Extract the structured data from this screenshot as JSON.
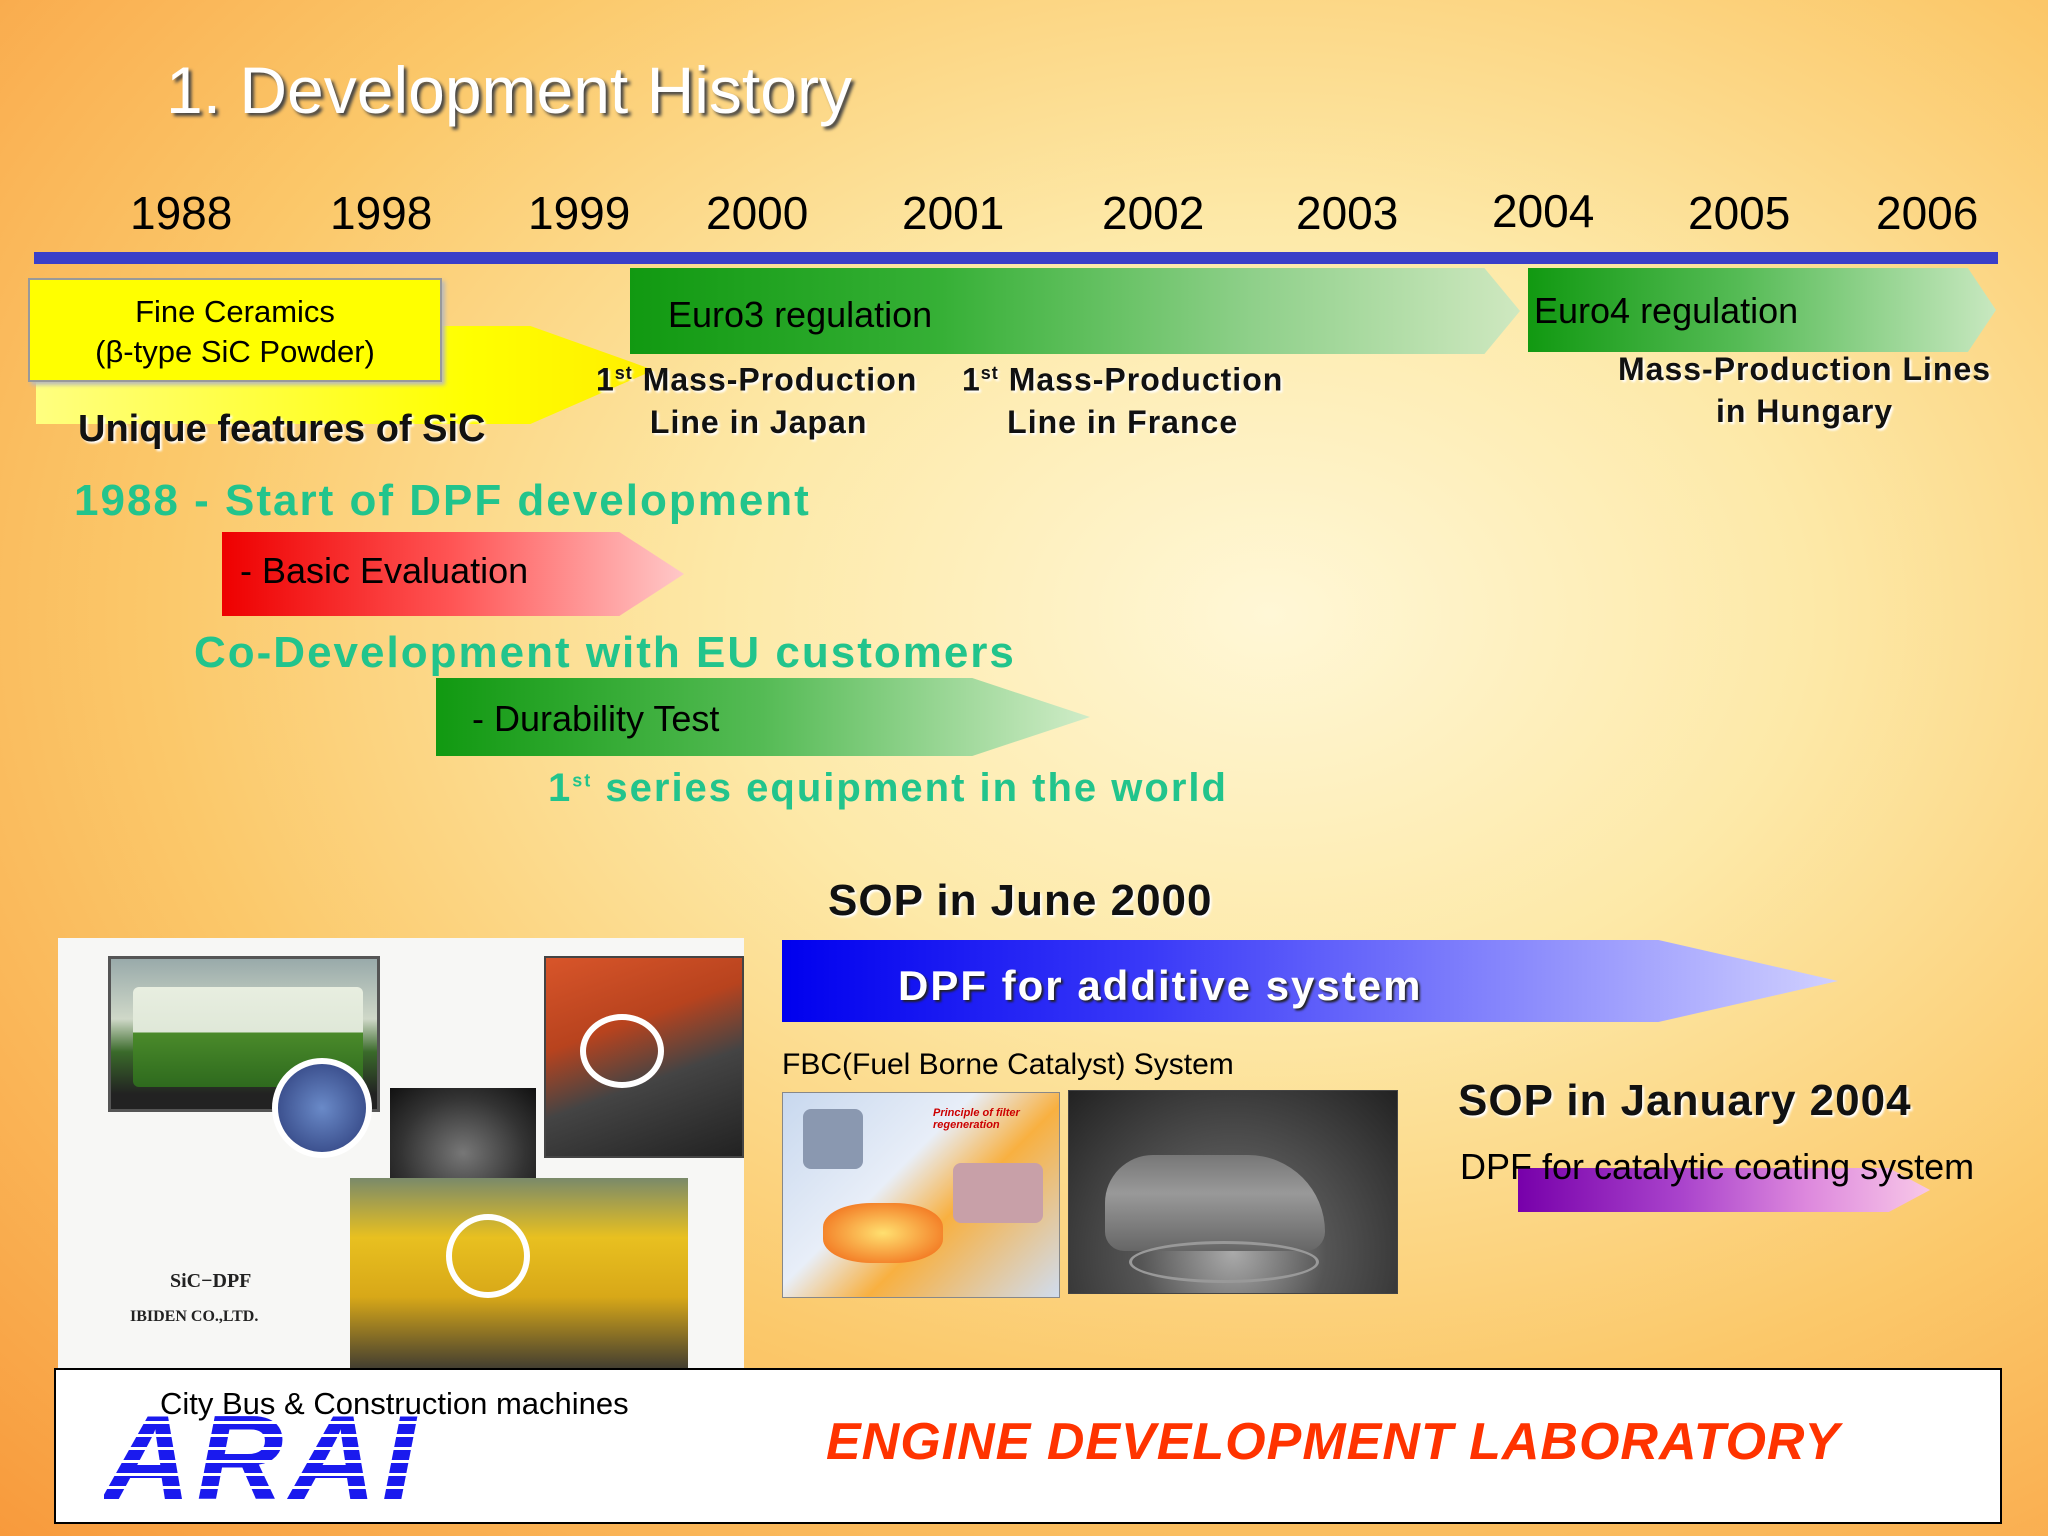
{
  "title": "1. Development History",
  "years": [
    "1988",
    "1998",
    "1999",
    "2000",
    "2001",
    "2002",
    "2003",
    "2004",
    "2005",
    "2006"
  ],
  "fine_ceramics": {
    "line1": "Fine Ceramics",
    "line2": "(β-type SiC Powder)"
  },
  "unique": "Unique features of SiC",
  "euro3": "Euro3 regulation",
  "euro4": "Euro4 regulation",
  "mp_japan": {
    "prefix": "1",
    "sup": "st",
    "line1": " Mass-Production",
    "line2": "Line in Japan"
  },
  "mp_france": {
    "prefix": "1",
    "sup": "st",
    "line1": " Mass-Production",
    "line2": "Line in France"
  },
  "mp_hungary": {
    "line1": "Mass-Production Lines",
    "line2": "in Hungary"
  },
  "dpf_start": "1988 - Start of DPF development",
  "basic_eval": "- Basic Evaluation",
  "co_dev": "Co-Development with EU customers",
  "durability": "- Durability Test",
  "first_series": {
    "prefix": "1",
    "sup": "st",
    "text": " series equipment in the world"
  },
  "sop1": "SOP in June 2000",
  "dpf_additive": "DPF for additive system",
  "fbc": "FBC(Fuel Borne Catalyst) System",
  "sop2": "SOP in January 2004",
  "dpf_catalytic": "DPF for catalytic coating system",
  "collage": {
    "caption1": "SiC−DPF",
    "caption2": "IBIDEN CO.,LTD."
  },
  "diagram_text": "Principle of filter regeneration",
  "city_bus": "City Bus & Construction machines",
  "footer": {
    "logo": "ARAI",
    "lab": "ENGINE DEVELOPMENT LABORATORY"
  },
  "colors": {
    "timeline": "#3a3fc8",
    "accent_green_text": "#22c48c",
    "lab_red": "#ff3300",
    "logo_blue": "#1a1aee"
  }
}
